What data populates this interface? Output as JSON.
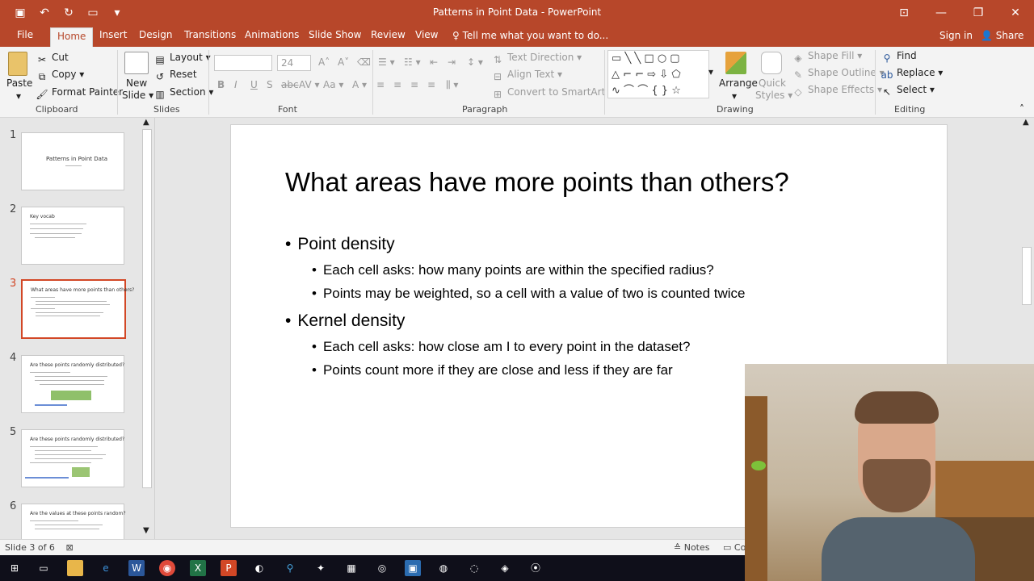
{
  "window": {
    "title": "Patterns in Point Data - PowerPoint"
  },
  "tabs": [
    "File",
    "Home",
    "Insert",
    "Design",
    "Transitions",
    "Animations",
    "Slide Show",
    "Review",
    "View"
  ],
  "active_tab": "Home",
  "tellme": "Tell me what you want to do...",
  "account": {
    "signin": "Sign in",
    "share": "Share"
  },
  "ribbon": {
    "clipboard": {
      "paste": "Paste",
      "cut": "Cut",
      "copy": "Copy",
      "format_painter": "Format Painter",
      "label": "Clipboard"
    },
    "slides": {
      "new_slide": "New",
      "new_slide2": "Slide",
      "layout": "Layout",
      "reset": "Reset",
      "section": "Section",
      "label": "Slides"
    },
    "font": {
      "size": "24",
      "label": "Font"
    },
    "paragraph": {
      "text_direction": "Text Direction",
      "align_text": "Align Text",
      "convert": "Convert to SmartArt",
      "label": "Paragraph"
    },
    "drawing": {
      "arrange": "Arrange",
      "quick_styles": "Quick",
      "quick_styles2": "Styles",
      "shape_fill": "Shape Fill",
      "shape_outline": "Shape Outline",
      "shape_effects": "Shape Effects",
      "label": "Drawing"
    },
    "editing": {
      "find": "Find",
      "replace": "Replace",
      "select": "Select",
      "label": "Editing"
    }
  },
  "thumbnails": [
    {
      "num": "1",
      "title": "Patterns in Point Data"
    },
    {
      "num": "2",
      "title": "Key vocab"
    },
    {
      "num": "3",
      "title": "What areas have more points than others?"
    },
    {
      "num": "4",
      "title": "Are these points randomly distributed?"
    },
    {
      "num": "5",
      "title": "Are these points randomly distributed?"
    },
    {
      "num": "6",
      "title": "Are the values at these points random?"
    }
  ],
  "slide": {
    "title": "What areas have more points than others?",
    "bullets": [
      {
        "text": "Point density",
        "sub": [
          "Each cell asks: how many points are within the specified radius?",
          "Points may be weighted, so a cell with a value of two is counted twice"
        ]
      },
      {
        "text": "Kernel density",
        "sub": [
          "Each cell asks: how close am I to every point in the dataset?",
          "Points count more if they are close and less if they are far"
        ]
      }
    ]
  },
  "status": {
    "slide_info": "Slide 3 of 6",
    "notes": "Notes",
    "comments": "Comments"
  }
}
